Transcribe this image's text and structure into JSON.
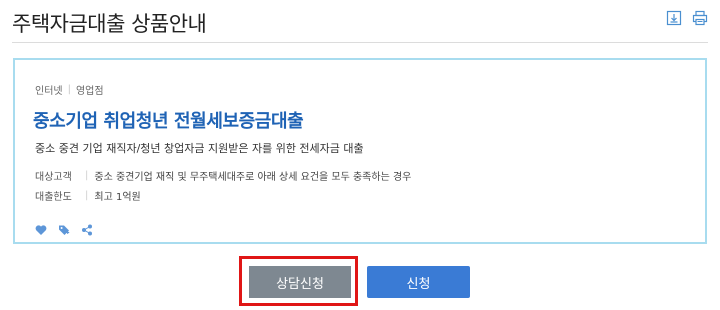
{
  "header": {
    "title": "주택자금대출 상품안내",
    "icons": [
      "download-icon",
      "print-icon"
    ]
  },
  "product": {
    "channels": [
      "인터넷",
      "영업점"
    ],
    "name": "중소기업 취업청년 전월세보증금대출",
    "description": "중소 중견 기업 재직자/청년 창업자금 지원받은 자를 위한 전세자금 대출",
    "details": [
      {
        "label": "대상고객",
        "value": "중소 중견기업 재직 및 무주택세대주로 아래 상세 요건을 모두 충족하는 경우"
      },
      {
        "label": "대출한도",
        "value": "최고 1억원"
      }
    ],
    "action_icons": [
      "heart-icon",
      "tag-icon",
      "share-icon"
    ]
  },
  "actions": {
    "consult_label": "상담신청",
    "apply_label": "신청"
  },
  "colors": {
    "accent_blue": "#1f63b5",
    "apply_button": "#3a7bd5",
    "consult_button": "#7e8891",
    "card_border": "#a8dcef",
    "highlight": "#e01616"
  }
}
